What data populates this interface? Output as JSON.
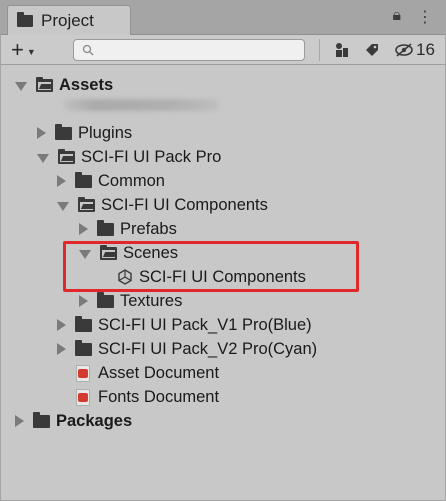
{
  "tab": {
    "label": "Project"
  },
  "toolbar": {
    "create_label": "+",
    "search_placeholder": "",
    "hidden_count": "16"
  },
  "tree": {
    "assets": "Assets",
    "plugins": "Plugins",
    "scifi_pack": "SCI-FI UI Pack Pro",
    "common": "Common",
    "components": "SCI-FI UI Components",
    "prefabs": "Prefabs",
    "scenes": "Scenes",
    "scene_file": "SCI-FI UI Components",
    "textures": "Textures",
    "pack_v1": "SCI-FI UI Pack_V1 Pro(Blue)",
    "pack_v2": "SCI-FI UI Pack_V2 Pro(Cyan)",
    "asset_doc": "Asset Document",
    "fonts_doc": "Fonts Document",
    "packages": "Packages"
  },
  "colors": {
    "highlight": "#e0272a",
    "panel": "#c8c8c8",
    "tabstrip": "#a5a5a5"
  }
}
